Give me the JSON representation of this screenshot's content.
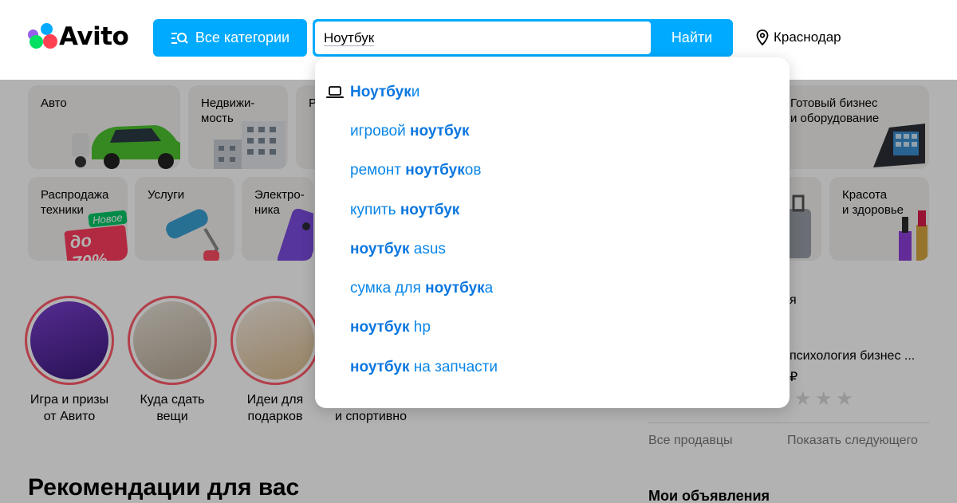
{
  "header": {
    "logo_text": "Avito",
    "categories_button": "Все категории",
    "search_value": "Ноутбук",
    "search_button": "Найти",
    "location": "Краснодар"
  },
  "categories": [
    {
      "label": "Авто"
    },
    {
      "label": "Недвижи-\nмость"
    },
    {
      "label": "Р"
    },
    {
      "label": "Готовый бизнес\nи оборудование"
    },
    {
      "label": "Распродажа\nтехники"
    },
    {
      "label": "Услуги"
    },
    {
      "label": "Электро-\nника"
    },
    {
      "label": "Красота\nи здоровье"
    }
  ],
  "promo_badges": {
    "new": "Новое",
    "discount": "до 70%"
  },
  "stories": [
    {
      "label": "Игра и призы\nот Авито"
    },
    {
      "label": "Куда сдать\nвещи"
    },
    {
      "label": "Идеи для\nподарков"
    },
    {
      "label": "и спортивно"
    }
  ],
  "recommendations_title": "Рекомендации для вас",
  "sidebar": {
    "fragment_letter": "я",
    "seller_item": "психология бизнес ...",
    "price_fragment": "₽",
    "all_sellers": "Все продавцы",
    "show_next": "Показать следующего",
    "my_ads": "Мои объявления"
  },
  "suggestions": [
    {
      "match": "Ноутбук",
      "before": "",
      "after": "и",
      "is_category": true,
      "icon": "laptop-icon"
    },
    {
      "before": "игровой ",
      "match": "ноутбук",
      "after": ""
    },
    {
      "before": "ремонт ",
      "match": "ноутбук",
      "after": "ов"
    },
    {
      "before": "купить ",
      "match": "ноутбук",
      "after": ""
    },
    {
      "before": "",
      "match": "ноутбук",
      "after": " asus"
    },
    {
      "before": "сумка для ",
      "match": "ноутбук",
      "after": "а"
    },
    {
      "before": "",
      "match": "ноутбук",
      "after": " hp"
    },
    {
      "before": "",
      "match": "ноутбук",
      "after": " на запчасти"
    }
  ],
  "colors": {
    "accent": "#00aaff",
    "link": "#0a86e8",
    "story_ring": "#ff5b6b"
  }
}
